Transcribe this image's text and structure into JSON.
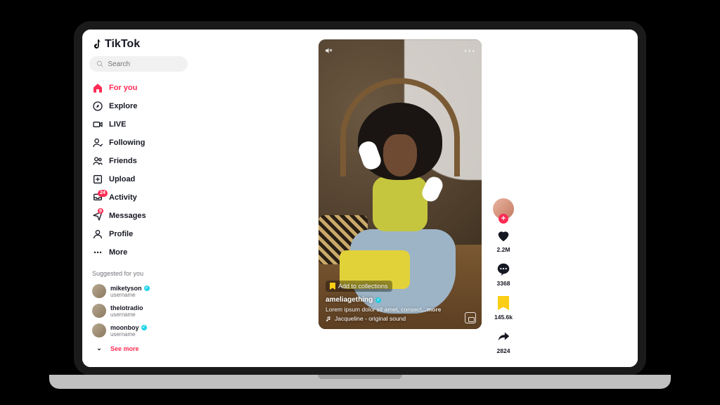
{
  "brand": "TikTok",
  "search": {
    "placeholder": "Search"
  },
  "nav": {
    "foryou": "For you",
    "explore": "Explore",
    "live": "LIVE",
    "following": "Following",
    "friends": "Friends",
    "upload": "Upload",
    "activity": "Activity",
    "activity_badge": "24",
    "messages": "Messages",
    "messages_badge": "9",
    "profile": "Profile",
    "more": "More"
  },
  "suggested": {
    "header": "Suggested for you",
    "items": [
      {
        "name": "miketyson",
        "sub": "username",
        "verified": true
      },
      {
        "name": "thelotradio",
        "sub": "username",
        "verified": false
      },
      {
        "name": "moonboy",
        "sub": "username",
        "verified": true
      }
    ],
    "see_more": "See more"
  },
  "video": {
    "add_collections": "Add to collections",
    "author": "ameliagething",
    "author_verified": true,
    "caption": "Lorem ipsum dolor sit amet, consect",
    "more": "...more",
    "sound": "Jacqueline - original sound"
  },
  "rail": {
    "likes": "2.2M",
    "comments": "3368",
    "saves": "145.6k",
    "shares": "2824"
  }
}
